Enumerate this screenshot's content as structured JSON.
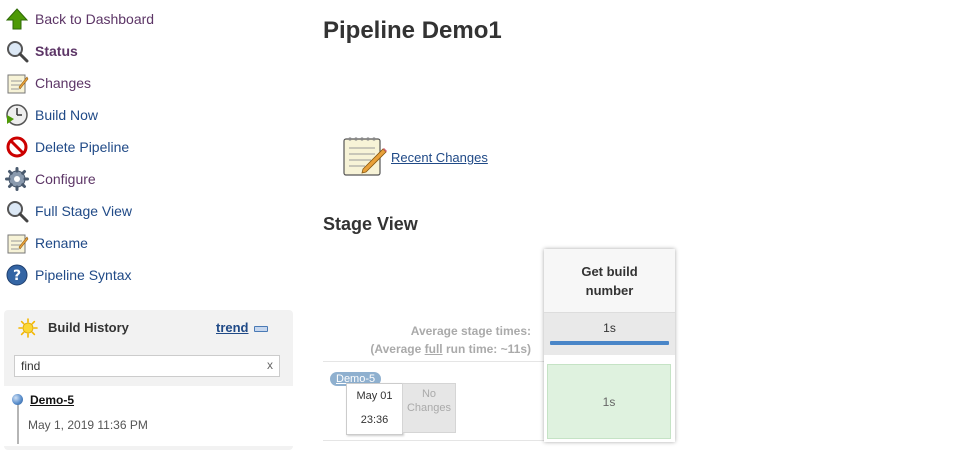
{
  "sidebar": {
    "items": [
      {
        "label": "Back to Dashboard",
        "icon": "up-arrow-icon"
      },
      {
        "label": "Status",
        "icon": "magnifier-icon"
      },
      {
        "label": "Changes",
        "icon": "notepad-icon"
      },
      {
        "label": "Build Now",
        "icon": "clock-play-icon"
      },
      {
        "label": "Delete Pipeline",
        "icon": "no-entry-icon"
      },
      {
        "label": "Configure",
        "icon": "gear-icon"
      },
      {
        "label": "Full Stage View",
        "icon": "magnifier-icon"
      },
      {
        "label": "Rename",
        "icon": "notepad-icon"
      },
      {
        "label": "Pipeline Syntax",
        "icon": "help-icon"
      }
    ]
  },
  "build_history": {
    "title": "Build History",
    "trend_label": "trend",
    "search_value": "find",
    "clear_label": "x",
    "builds": [
      {
        "name": "Demo-5",
        "date": "May 1, 2019 11:36 PM",
        "status_color": "#5b8fcc"
      }
    ]
  },
  "main": {
    "title": "Pipeline Demo1",
    "recent_changes_label": "Recent Changes",
    "stage_view_title": "Stage View"
  },
  "stage_view": {
    "avg_label_line1": "Average stage times:",
    "avg_label_line2_pre": "(Average ",
    "avg_label_line2_link": "full",
    "avg_label_line2_post": " run time: ~11s)",
    "stage": {
      "name": "Get build number",
      "avg_time": "1s",
      "avg_bar_fraction": 1.0
    },
    "runs": [
      {
        "badge": "Demo-5",
        "date": "May 01",
        "time": "23:36",
        "changes": "No Changes",
        "stage_time": "1s",
        "status": "success"
      }
    ]
  },
  "colors": {
    "link": "#204a87",
    "visited": "#5c3566",
    "success_cell": "#dff2df",
    "avg_bar": "#4a86c8"
  }
}
